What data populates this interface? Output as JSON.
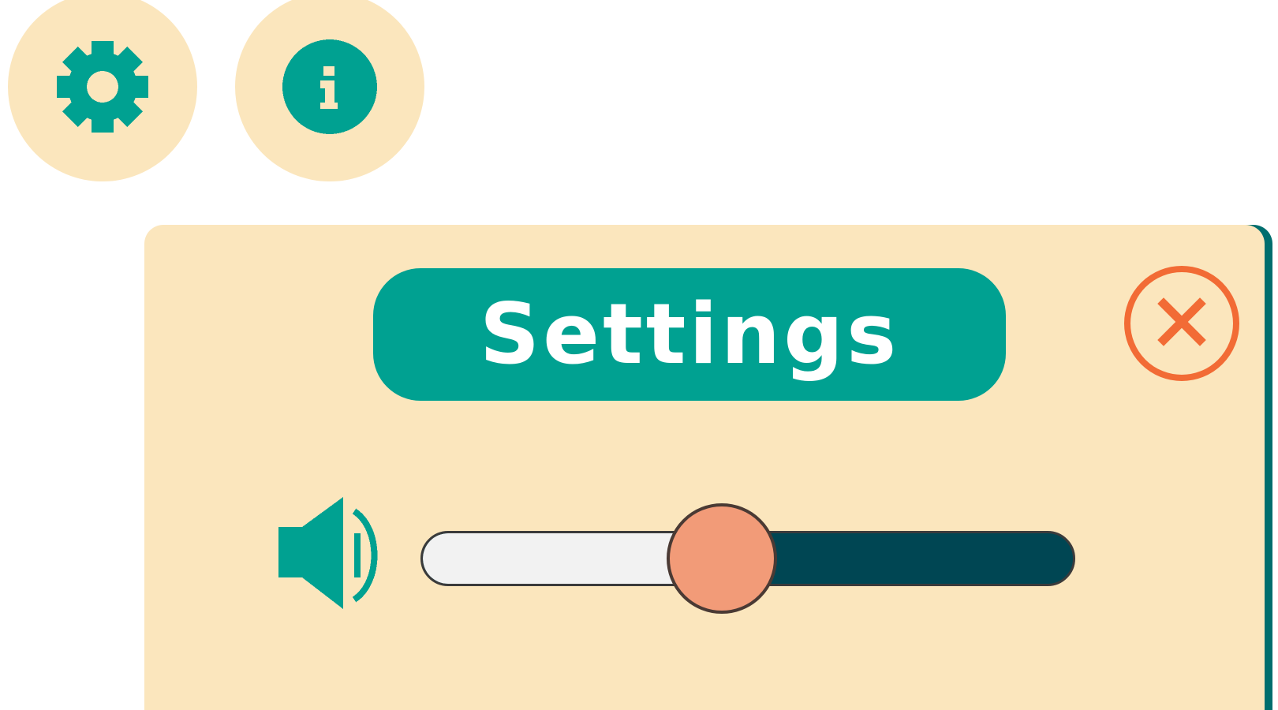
{
  "toolbar": {
    "settings_icon": "gear-icon",
    "info_icon": "info-icon"
  },
  "settings_panel": {
    "title": "Settings",
    "close_icon": "close-icon",
    "volume": {
      "icon": "speaker-icon",
      "level": 0.46
    }
  },
  "colors": {
    "teal": "#00a191",
    "cream": "#fbe6bd",
    "orange": "#f26b35",
    "dark_teal": "#004653",
    "thumb": "#f29b78"
  }
}
